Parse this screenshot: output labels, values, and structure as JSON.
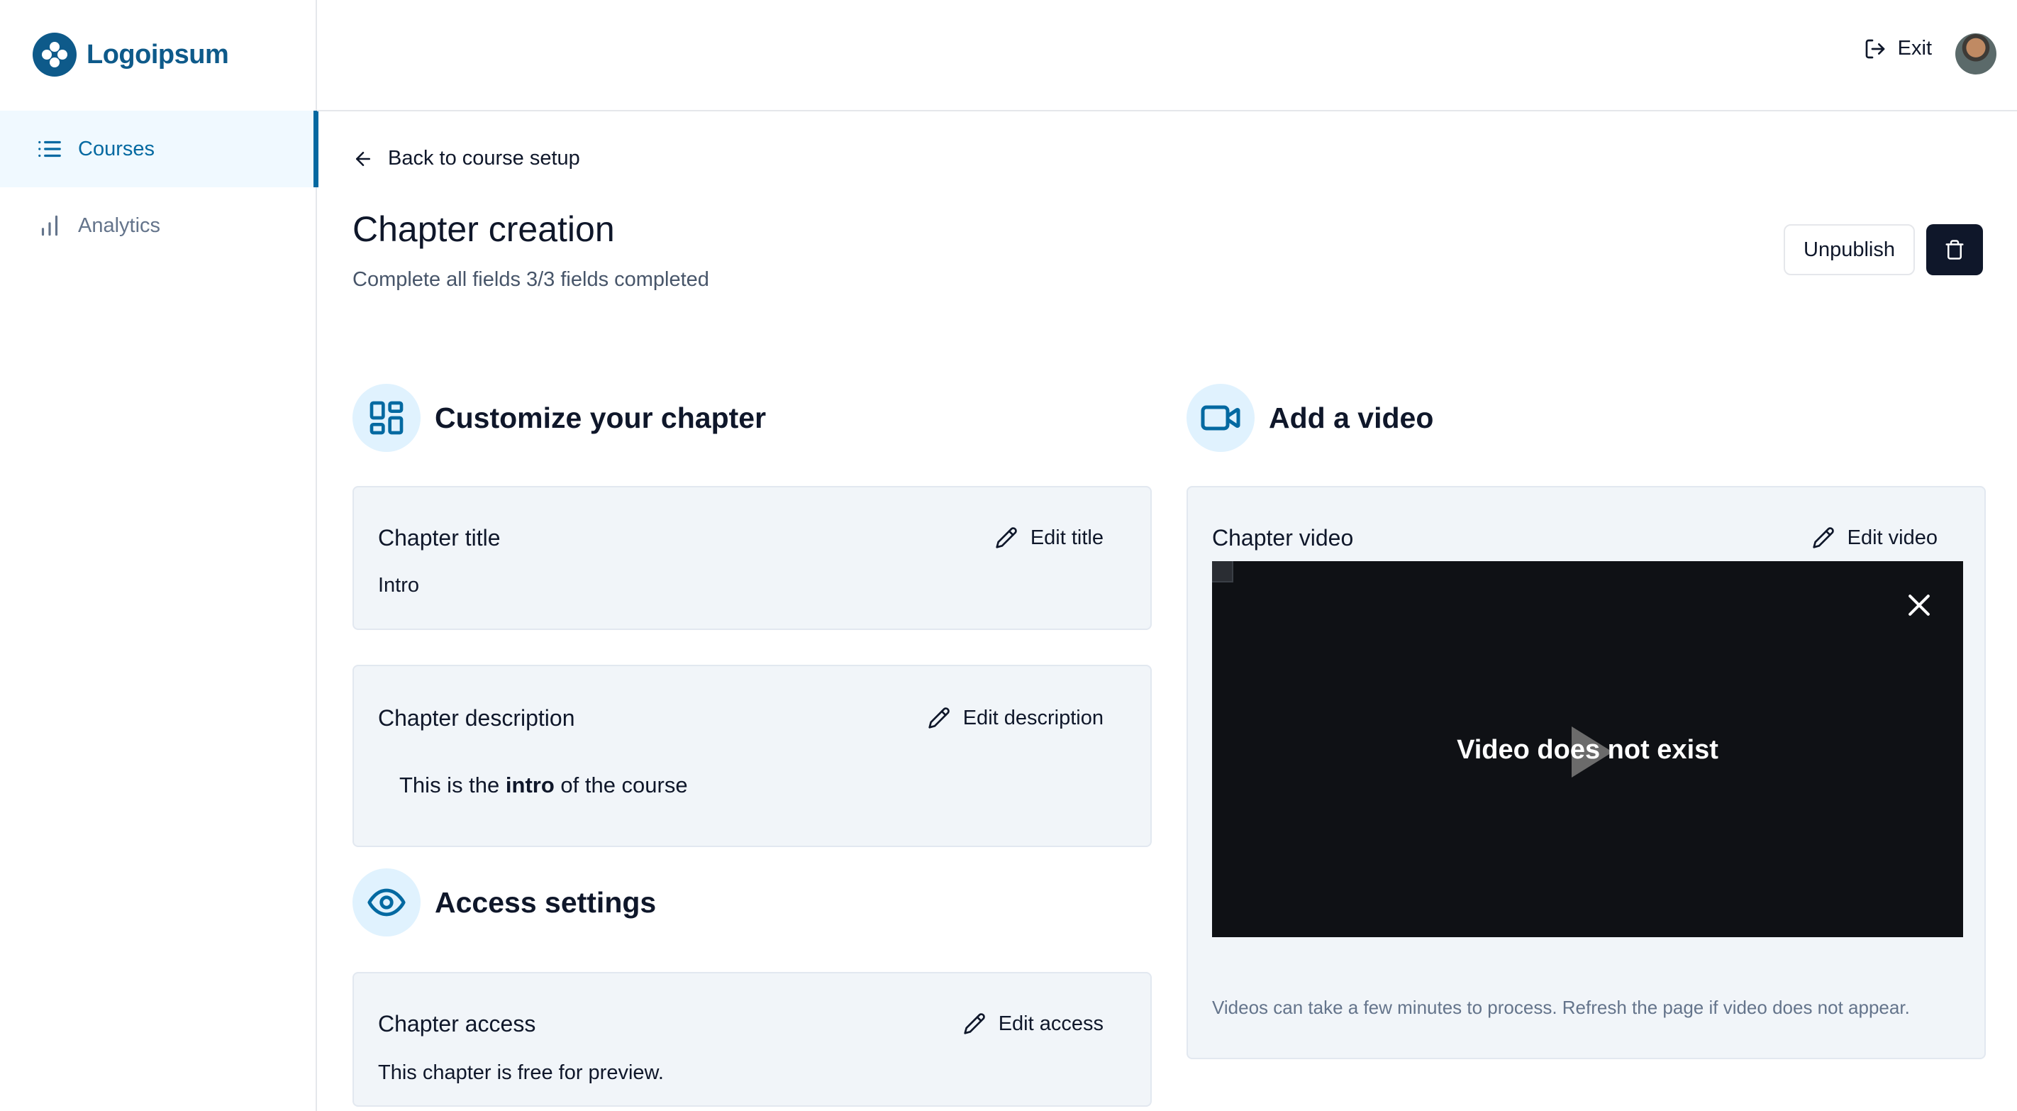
{
  "brand": {
    "name": "Logoipsum",
    "color": "#0e5a8a"
  },
  "sidebar": {
    "items": [
      {
        "label": "Courses",
        "icon": "list-icon",
        "active": true
      },
      {
        "label": "Analytics",
        "icon": "bar-chart-icon",
        "active": false
      }
    ]
  },
  "topbar": {
    "exit_label": "Exit",
    "exit_icon": "log-out-icon"
  },
  "page": {
    "back_label": "Back to course setup",
    "title": "Chapter creation",
    "subtitle": "Complete all fields 3/3 fields completed",
    "unpublish_label": "Unpublish"
  },
  "customize": {
    "title": "Customize your chapter",
    "chapter_title": {
      "label": "Chapter title",
      "edit_label": "Edit title",
      "value": "Intro"
    },
    "chapter_description": {
      "label": "Chapter description",
      "edit_label": "Edit description",
      "value_before": "This is the ",
      "value_bold": "intro",
      "value_after": " of the course"
    }
  },
  "access": {
    "title": "Access settings",
    "chapter_access": {
      "label": "Chapter access",
      "edit_label": "Edit access",
      "value": "This chapter is free for preview."
    }
  },
  "video": {
    "title": "Add a video",
    "label": "Chapter video",
    "edit_label": "Edit video",
    "message": "Video does not exist",
    "note": "Videos can take a few minutes to process. Refresh the page if video does not appear."
  },
  "colors": {
    "accent": "#0369a1",
    "accent_bg": "#e0f2fe",
    "dark": "#0f172a",
    "card_bg": "#f1f5f9"
  }
}
